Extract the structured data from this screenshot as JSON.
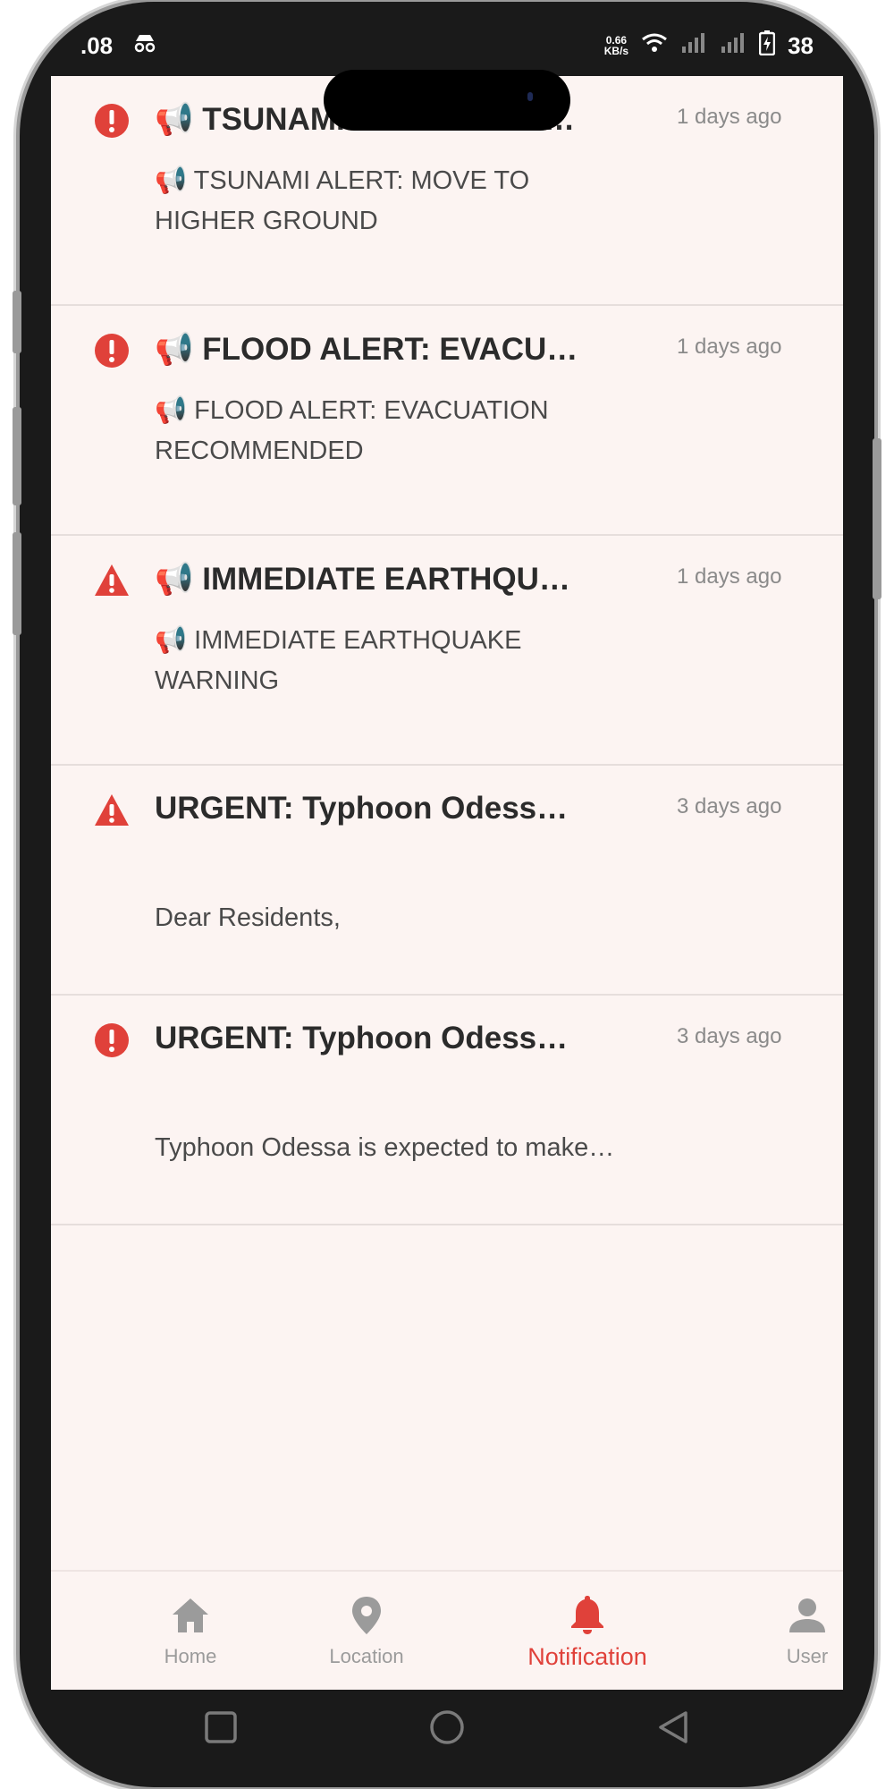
{
  "status_bar": {
    "time": ".08",
    "net_speed_value": "0.66",
    "net_speed_unit": "KB/s",
    "battery": "38"
  },
  "notifications": [
    {
      "icon": "alert-circle-icon",
      "title": "📢 TSUNAMI ALERT: MOVE TO HIGHER GROUND",
      "time": "1 days ago",
      "body": "📢 TSUNAMI ALERT: MOVE TO HIGHER GROUND"
    },
    {
      "icon": "alert-circle-icon",
      "title": "📢 FLOOD ALERT: EVACUATION RECOMMENDED",
      "time": "1 days ago",
      "body": "📢 FLOOD ALERT: EVACUATION RECOMMENDED"
    },
    {
      "icon": "warning-triangle-icon",
      "title": "📢 IMMEDIATE EARTHQUAKE WARNING",
      "time": "1 days ago",
      "body": "📢 IMMEDIATE EARTHQUAKE WARNING"
    },
    {
      "icon": "warning-triangle-icon",
      "title": "URGENT: Typhoon Odessa Approaching",
      "time": "3 days ago",
      "body": "Dear Residents,"
    },
    {
      "icon": "alert-circle-icon",
      "title": "URGENT: Typhoon Odessa Approaching",
      "time": "3 days ago",
      "body": "Typhoon Odessa is expected to make landfall"
    }
  ],
  "bottom_nav": {
    "home": "Home",
    "location": "Location",
    "notification": "Notification",
    "user": "User"
  },
  "colors": {
    "accent": "#e0413a",
    "background": "#fcf4f2",
    "inactive": "#9b9b9b"
  }
}
